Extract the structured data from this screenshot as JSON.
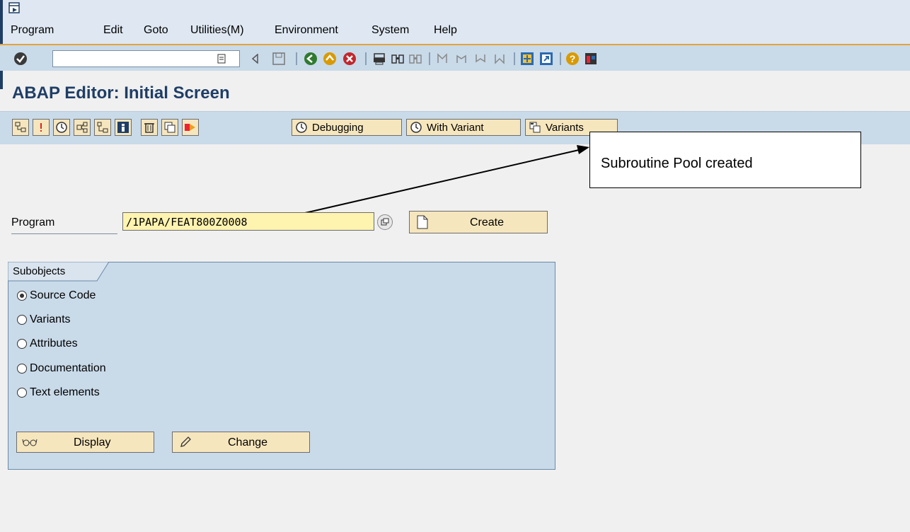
{
  "menu": {
    "items": [
      {
        "label": "Program"
      },
      {
        "label": "Edit"
      },
      {
        "label": "Goto"
      },
      {
        "label": "Utilities(M)"
      },
      {
        "label": "Environment"
      },
      {
        "label": "System"
      },
      {
        "label": "Help"
      }
    ]
  },
  "toolbar": {
    "command_value": ""
  },
  "title": "ABAP Editor: Initial Screen",
  "app_toolbar": {
    "debugging_label": "Debugging",
    "with_variant_label": "With Variant",
    "variants_label": "Variants"
  },
  "callout": {
    "text": "Subroutine Pool created"
  },
  "program": {
    "label": "Program",
    "value": "/1PAPA/FEAT800Z0008",
    "create_label": "Create"
  },
  "subobjects": {
    "title": "Subobjects",
    "options": [
      {
        "label": "Source Code",
        "selected": true
      },
      {
        "label": "Variants",
        "selected": false
      },
      {
        "label": "Attributes",
        "selected": false
      },
      {
        "label": "Documentation",
        "selected": false
      },
      {
        "label": "Text elements",
        "selected": false
      }
    ],
    "display_label": "Display",
    "change_label": "Change"
  },
  "colors": {
    "accent_orange": "#e6a23c",
    "title_blue": "#1f3e66",
    "button_fill": "#f6e6bd",
    "input_fill": "#fff3b0",
    "toolbar_blue": "#c9dae9"
  }
}
